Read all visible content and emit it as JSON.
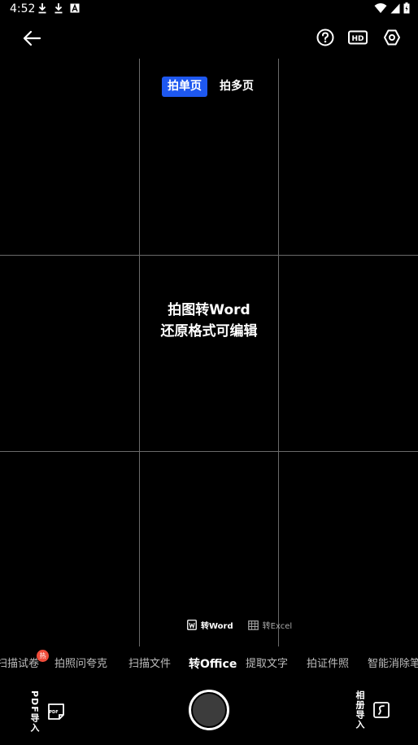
{
  "status_bar": {
    "time": "4:52",
    "left_icons": [
      "download-icon",
      "download-icon",
      "a-icon"
    ],
    "right_icons": [
      "wifi-icon",
      "signal-icon",
      "battery-icon"
    ]
  },
  "top_bar": {
    "icons": [
      "back-arrow-icon",
      "help-icon",
      "hd-icon",
      "settings-icon"
    ],
    "hd_label": "HD"
  },
  "capture_mode": {
    "single_label": "拍单页",
    "multi_label": "拍多页",
    "selected": "拍单页"
  },
  "hint": {
    "line1": "拍图转Word",
    "line2": "还原格式可编辑"
  },
  "sub_modes": [
    {
      "label": "转Word",
      "icon": "word-doc-icon",
      "active": true
    },
    {
      "label": "转Excel",
      "icon": "table-icon",
      "active": false
    }
  ],
  "mode_tabs": [
    {
      "label": "扫描试卷",
      "badge": "热"
    },
    {
      "label": "拍照问夸克"
    },
    {
      "label": "扫描文件"
    },
    {
      "label": "转Office",
      "active": true
    },
    {
      "label": "提取文字"
    },
    {
      "label": "拍证件照"
    },
    {
      "label": "智能消除笔"
    }
  ],
  "bottom": {
    "pdf_import_label": "PDF导入",
    "pdf_icon_text": "PDF",
    "album_import_label": "相册导入"
  },
  "colors": {
    "accent": "#1e58f0",
    "badge": "#ef4b3a",
    "background": "#000000"
  }
}
